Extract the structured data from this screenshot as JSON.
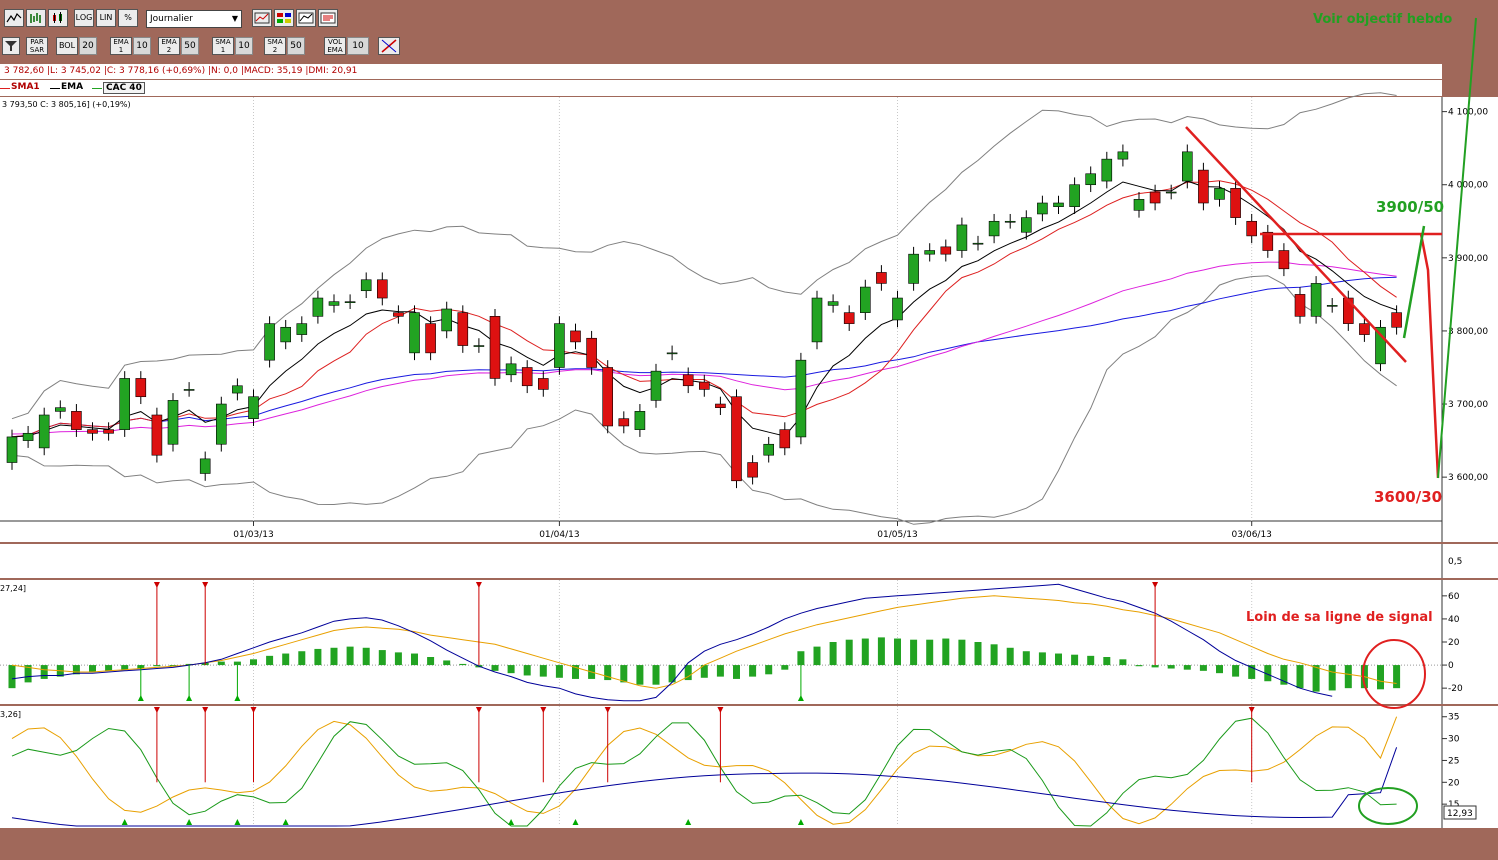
{
  "toolbar1": {
    "log_label": "LOG",
    "lin_label": "LIN",
    "pct_label": "%",
    "period_select": "Journalier"
  },
  "toolbar2": {
    "par_sar_label": "PAR SAR",
    "bol_label": "BOL",
    "bol_value": "20",
    "ema1_label": "EMA 1",
    "ema1_value": "10",
    "ema2_label": "EMA 2",
    "ema2_value": "50",
    "sma1_label": "SMA 1",
    "sma1_value": "10",
    "sma2_label": "SMA 2",
    "sma2_value": "50",
    "volema_label": "VOL EMA",
    "volema_value": "10"
  },
  "info": {
    "ohlc_line": "3 782,60 |L: 3 745,02 |C: 3 778,16 (+0,69%) |N: 0,0 |MACD: 35,19 |DMI: 20,91",
    "legend_sma": "SMA1",
    "legend_ema": "EMA",
    "legend_cac": "CAC 40",
    "price_line": "3 793,50   C: 3 805,16] (+0,19%)",
    "macd_tag": "27,24]",
    "dmi_tag": "3,26]"
  },
  "annotations": {
    "weekly_target": "Voir objectif hebdo",
    "target_up": "3900/50",
    "target_down": "3600/30",
    "signal_note": "Loin de sa ligne de signal"
  },
  "colors": {
    "frame": "#a0685a",
    "candle_up": "#22a322",
    "candle_down": "#dd1111",
    "bollinger": "#808080",
    "ema": "#000000",
    "sma1": "#dd2020",
    "sma_blue": "#1a1ae0",
    "sma_magenta": "#dd22dd",
    "macd_line": "#000099",
    "signal_line": "#e8a000",
    "annotation_red": "#e02020",
    "annotation_green": "#22a022"
  },
  "chart_data": [
    {
      "type": "candlestick",
      "name": "CAC 40",
      "x_ticks": [
        "01/03/13",
        "01/04/13",
        "01/05/13",
        "03/06/13"
      ],
      "y_ticks": [
        "3 600,00",
        "3 700,00",
        "3 800,00",
        "3 900,00",
        "4 000,00",
        "4 100,00"
      ],
      "ylim": [
        3540,
        4120
      ],
      "candles": [
        {
          "o": 3620,
          "c": 3655
        },
        {
          "o": 3650,
          "c": 3660
        },
        {
          "o": 3640,
          "c": 3685
        },
        {
          "o": 3690,
          "c": 3695
        },
        {
          "o": 3690,
          "c": 3665
        },
        {
          "o": 3665,
          "c": 3660
        },
        {
          "o": 3665,
          "c": 3660
        },
        {
          "o": 3665,
          "c": 3735
        },
        {
          "o": 3735,
          "c": 3710
        },
        {
          "o": 3685,
          "c": 3630
        },
        {
          "o": 3645,
          "c": 3705
        },
        {
          "o": 3720,
          "c": 3720
        },
        {
          "o": 3605,
          "c": 3625
        },
        {
          "o": 3645,
          "c": 3700
        },
        {
          "o": 3715,
          "c": 3725
        },
        {
          "o": 3680,
          "c": 3710
        },
        {
          "o": 3760,
          "c": 3810
        },
        {
          "o": 3785,
          "c": 3805
        },
        {
          "o": 3795,
          "c": 3810
        },
        {
          "o": 3820,
          "c": 3845
        },
        {
          "o": 3835,
          "c": 3840
        },
        {
          "o": 3840,
          "c": 3840
        },
        {
          "o": 3855,
          "c": 3870
        },
        {
          "o": 3870,
          "c": 3845
        },
        {
          "o": 3825,
          "c": 3820
        },
        {
          "o": 3770,
          "c": 3825
        },
        {
          "o": 3810,
          "c": 3770
        },
        {
          "o": 3800,
          "c": 3830
        },
        {
          "o": 3825,
          "c": 3780
        },
        {
          "o": 3780,
          "c": 3780
        },
        {
          "o": 3820,
          "c": 3735
        },
        {
          "o": 3740,
          "c": 3755
        },
        {
          "o": 3750,
          "c": 3725
        },
        {
          "o": 3735,
          "c": 3720
        },
        {
          "o": 3750,
          "c": 3810
        },
        {
          "o": 3800,
          "c": 3785
        },
        {
          "o": 3790,
          "c": 3750
        },
        {
          "o": 3750,
          "c": 3670
        },
        {
          "o": 3680,
          "c": 3670
        },
        {
          "o": 3665,
          "c": 3690
        },
        {
          "o": 3705,
          "c": 3745
        },
        {
          "o": 3770,
          "c": 3770
        },
        {
          "o": 3740,
          "c": 3725
        },
        {
          "o": 3730,
          "c": 3720
        },
        {
          "o": 3700,
          "c": 3695
        },
        {
          "o": 3710,
          "c": 3595
        },
        {
          "o": 3620,
          "c": 3600
        },
        {
          "o": 3630,
          "c": 3645
        },
        {
          "o": 3665,
          "c": 3640
        },
        {
          "o": 3655,
          "c": 3760
        },
        {
          "o": 3785,
          "c": 3845
        },
        {
          "o": 3835,
          "c": 3840
        },
        {
          "o": 3825,
          "c": 3810
        },
        {
          "o": 3825,
          "c": 3860
        },
        {
          "o": 3880,
          "c": 3865
        },
        {
          "o": 3815,
          "c": 3845
        },
        {
          "o": 3865,
          "c": 3905
        },
        {
          "o": 3905,
          "c": 3910
        },
        {
          "o": 3915,
          "c": 3905
        },
        {
          "o": 3910,
          "c": 3945
        },
        {
          "o": 3920,
          "c": 3920
        },
        {
          "o": 3930,
          "c": 3950
        },
        {
          "o": 3950,
          "c": 3950
        },
        {
          "o": 3935,
          "c": 3955
        },
        {
          "o": 3960,
          "c": 3975
        },
        {
          "o": 3970,
          "c": 3975
        },
        {
          "o": 3970,
          "c": 4000
        },
        {
          "o": 4000,
          "c": 4015
        },
        {
          "o": 4005,
          "c": 4035
        },
        {
          "o": 4035,
          "c": 4045
        },
        {
          "o": 3965,
          "c": 3980
        },
        {
          "o": 3990,
          "c": 3975
        },
        {
          "o": 3990,
          "c": 3990
        },
        {
          "o": 4005,
          "c": 4045
        },
        {
          "o": 4020,
          "c": 3975
        },
        {
          "o": 3980,
          "c": 3995
        },
        {
          "o": 3995,
          "c": 3955
        },
        {
          "o": 3950,
          "c": 3930
        },
        {
          "o": 3935,
          "c": 3910
        },
        {
          "o": 3910,
          "c": 3885
        },
        {
          "o": 3850,
          "c": 3820
        },
        {
          "o": 3820,
          "c": 3865
        },
        {
          "o": 3835,
          "c": 3835
        },
        {
          "o": 3845,
          "c": 3810
        },
        {
          "o": 3810,
          "c": 3795
        },
        {
          "o": 3755,
          "c": 3805
        },
        {
          "o": 3825,
          "c": 3805
        }
      ]
    },
    {
      "type": "bar",
      "name": "MACD",
      "y_ticks": [
        "60",
        "40",
        "20",
        "0",
        "-20"
      ],
      "ylim": [
        -32,
        72
      ],
      "histogram": [
        -20,
        -15,
        -12,
        -10,
        -8,
        -6,
        -5,
        -4,
        -3,
        -1,
        0,
        1,
        2,
        3,
        3,
        5,
        8,
        10,
        12,
        14,
        15,
        16,
        15,
        13,
        11,
        10,
        7,
        4,
        1,
        -2,
        -5,
        -7,
        -9,
        -10,
        -11,
        -12,
        -12,
        -13,
        -15,
        -17,
        -17,
        -15,
        -13,
        -11,
        -10,
        -12,
        -10,
        -8,
        -4,
        12,
        16,
        20,
        22,
        23,
        24,
        23,
        22,
        22,
        23,
        22,
        20,
        18,
        15,
        12,
        11,
        10,
        9,
        8,
        7,
        5,
        -1,
        -2,
        -3,
        -4,
        -5,
        -7,
        -10,
        -12,
        -14,
        -17,
        -20,
        -23,
        -22,
        -20,
        -20,
        -21,
        -20
      ],
      "macd_line": [
        -12,
        -10,
        -9,
        -9,
        -7,
        -7,
        -6,
        -5,
        -4,
        -3,
        -2,
        0,
        2,
        5,
        10,
        15,
        20,
        24,
        28,
        33,
        38,
        40,
        41,
        39,
        34,
        28,
        21,
        13,
        6,
        -1,
        -6,
        -10,
        -15,
        -18,
        -20,
        -25,
        -28,
        -30,
        -31,
        -31,
        -28,
        -15,
        2,
        12,
        18,
        22,
        27,
        33,
        40,
        45,
        49,
        52,
        55,
        58,
        59,
        60,
        61,
        62,
        63,
        64,
        65,
        66,
        67,
        68,
        69,
        70,
        66,
        62,
        58,
        55,
        50,
        45,
        38,
        30,
        22,
        12,
        4,
        -2,
        -8,
        -14,
        -20,
        -24,
        -27
      ],
      "signal_line": [
        0,
        -2,
        -4,
        -5,
        -6,
        -6,
        -5,
        -4,
        -3,
        -2,
        -1,
        0,
        2,
        4,
        7,
        10,
        14,
        18,
        22,
        26,
        30,
        32,
        33,
        32,
        31,
        29,
        26,
        24,
        22,
        20,
        18,
        14,
        10,
        6,
        2,
        -2,
        -6,
        -10,
        -14,
        -18,
        -20,
        -17,
        -10,
        0,
        6,
        12,
        17,
        22,
        27,
        31,
        35,
        38,
        41,
        44,
        47,
        50,
        52,
        54,
        56,
        58,
        59,
        60,
        59,
        58,
        57,
        56,
        54,
        53,
        51,
        48,
        46,
        43,
        40,
        36,
        32,
        28,
        22,
        16,
        10,
        5,
        2,
        -2,
        -6,
        -8,
        -10,
        -14,
        -16
      ]
    },
    {
      "type": "line",
      "name": "DMI",
      "y_ticks": [
        "35",
        "30",
        "25",
        "20",
        "15"
      ],
      "ylim": [
        10,
        37
      ],
      "last_value": "12,93"
    }
  ]
}
